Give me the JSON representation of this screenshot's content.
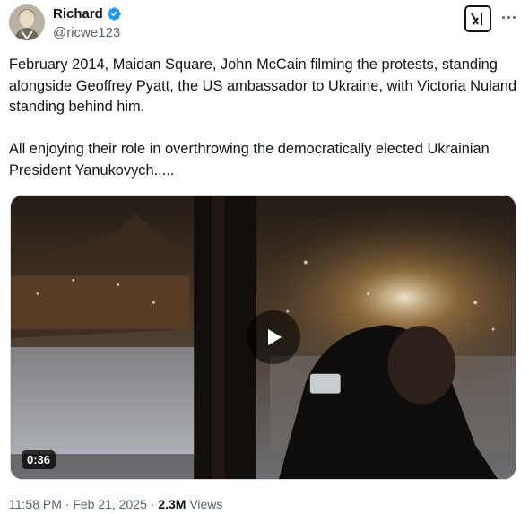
{
  "author": {
    "display_name": "Richard",
    "handle": "@ricwe123"
  },
  "tweet": {
    "paragraphs": [
      "February 2014, Maidan Square, John McCain filming the protests, standing alongside Geoffrey Pyatt, the US ambassador to Ukraine, with Victoria Nuland standing behind him.",
      "All enjoying their role in overthrowing the democratically elected Ukrainian President Yanukovych....."
    ]
  },
  "video": {
    "duration": "0:36"
  },
  "meta": {
    "time": "11:58 PM",
    "separator": " · ",
    "date": "Feb 21, 2025",
    "separator2": " · ",
    "views_count": "2.3M",
    "views_label": " Views"
  },
  "colors": {
    "verified": "#1d9bf0",
    "secondary_text": "#536471"
  }
}
